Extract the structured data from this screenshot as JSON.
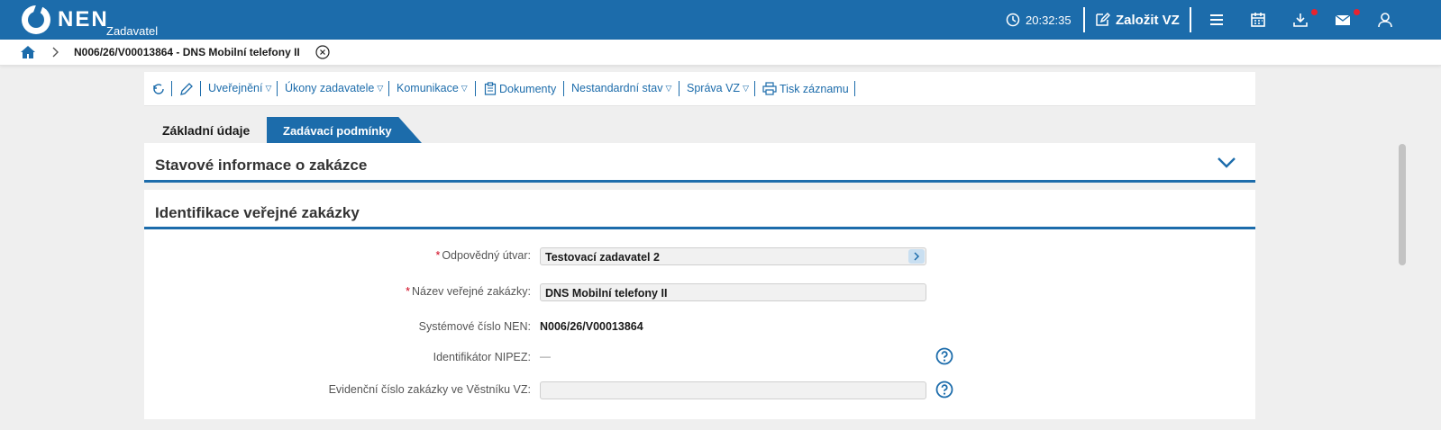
{
  "app": {
    "brand": "NEN",
    "subtitle": "Zadavatel"
  },
  "header": {
    "time": "20:32:35",
    "create_label": "Založit VZ",
    "icons": [
      "clock-icon",
      "edit-icon",
      "menu-icon",
      "calendar-icon",
      "download-icon",
      "mail-icon",
      "user-icon"
    ]
  },
  "breadcrumb": {
    "title": "N006/26/V00013864 - DNS Mobilní telefony II"
  },
  "toolbar": {
    "items": [
      "Uveřejnění",
      "Úkony zadavatele",
      "Komunikace",
      "Dokumenty",
      "Nestandardní stav",
      "Správa VZ",
      "Tisk záznamu"
    ]
  },
  "tabs": {
    "basic": "Základní údaje",
    "conditions": "Zadávací podmínky"
  },
  "sections": {
    "status": "Stavové informace o zakázce",
    "identification": "Identifikace veřejné zakázky"
  },
  "form": {
    "department_label": "Odpovědný útvar:",
    "department_value": "Testovací zadavatel 2",
    "name_label": "Název veřejné zakázky:",
    "name_value": "DNS Mobilní telefony II",
    "system_no_label": "Systémové číslo NEN:",
    "system_no_value": "N006/26/V00013864",
    "nipez_label": "Identifikátor NIPEZ:",
    "nipez_value": "—",
    "vestnik_label": "Evidenční číslo zakázky ve Věstníku VZ:",
    "vestnik_value": ""
  },
  "colors": {
    "primary": "#1c6cab",
    "required": "#d0021b",
    "notification": "#e8232f"
  }
}
